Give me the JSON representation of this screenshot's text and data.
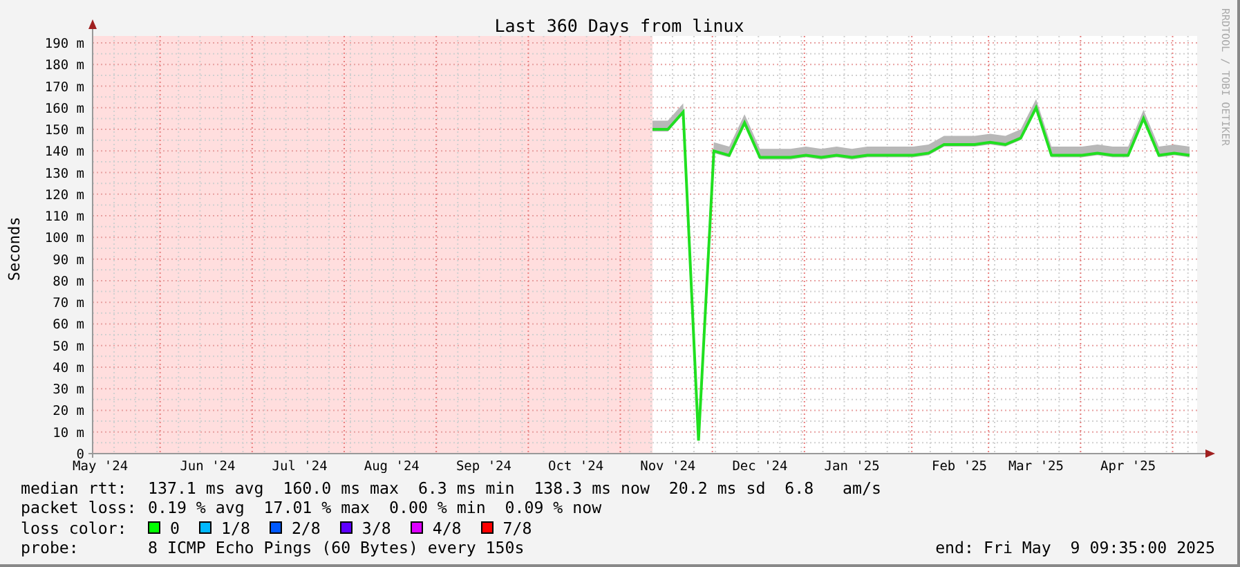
{
  "graph": {
    "credit": "RRDTOOL / TOBI OETIKER",
    "chart_data": {
      "type": "line",
      "title": "Last 360 Days from linux",
      "ylabel": "Seconds",
      "categories": [
        "May '24",
        null,
        null,
        null,
        null,
        null,
        null,
        "Jun '24",
        null,
        null,
        null,
        null,
        null,
        "Jul '24",
        null,
        null,
        null,
        null,
        null,
        "Aug '24",
        null,
        null,
        null,
        null,
        null,
        "Sep '24",
        null,
        null,
        null,
        null,
        null,
        "Oct '24",
        null,
        null,
        null,
        null,
        null,
        "Nov '24",
        null,
        null,
        null,
        null,
        null,
        "Dec '24",
        null,
        null,
        null,
        null,
        null,
        "Jan '25",
        null,
        null,
        null,
        null,
        null,
        null,
        "Feb '25",
        null,
        null,
        null,
        null,
        "Mar '25",
        null,
        null,
        null,
        null,
        null,
        "Apr '25",
        null,
        null,
        null,
        null
      ],
      "series": [
        {
          "name": "median rtt:",
          "color": "#20e020",
          "values": [
            null,
            null,
            null,
            null,
            null,
            null,
            null,
            null,
            null,
            null,
            null,
            null,
            null,
            null,
            null,
            null,
            null,
            null,
            null,
            null,
            null,
            null,
            null,
            null,
            null,
            null,
            null,
            null,
            null,
            null,
            null,
            null,
            null,
            null,
            null,
            null,
            150,
            150,
            158,
            6,
            140,
            138,
            153,
            137,
            137,
            137,
            138,
            137,
            138,
            137,
            138,
            138,
            138,
            138,
            139,
            143,
            143,
            143,
            144,
            143,
            146,
            160,
            138,
            138,
            138,
            139,
            138,
            138,
            155,
            138,
            139,
            138
          ]
        }
      ],
      "ylim": [
        0,
        190
      ],
      "grid": true,
      "yticks": [
        {
          "value": 0,
          "label": "0"
        },
        {
          "value": 10,
          "label": "10 m"
        },
        {
          "value": 20,
          "label": "20 m"
        },
        {
          "value": 30,
          "label": "30 m"
        },
        {
          "value": 40,
          "label": "40 m"
        },
        {
          "value": 50,
          "label": "50 m"
        },
        {
          "value": 60,
          "label": "60 m"
        },
        {
          "value": 70,
          "label": "70 m"
        },
        {
          "value": 80,
          "label": "80 m"
        },
        {
          "value": 90,
          "label": "90 m"
        },
        {
          "value": 100,
          "label": "100 m"
        },
        {
          "value": 110,
          "label": "110 m"
        },
        {
          "value": 120,
          "label": "120 m"
        },
        {
          "value": 130,
          "label": "130 m"
        },
        {
          "value": 140,
          "label": "140 m"
        },
        {
          "value": 150,
          "label": "150 m"
        },
        {
          "value": 160,
          "label": "160 m"
        },
        {
          "value": 170,
          "label": "170 m"
        },
        {
          "value": 180,
          "label": "180 m"
        },
        {
          "value": 190,
          "label": "190 m"
        }
      ]
    }
  },
  "legend": {
    "rows": [
      {
        "value": "137.1 ms avg  160.0 ms max  6.3 ms min  138.3 ms now  20.2 ms sd  6.8   am/s"
      },
      {
        "label": "packet loss:",
        "value": "0.19 % avg  17.01 % max  0.00 % min  0.09 % now"
      }
    ],
    "loss_colors": {
      "label": "loss color:",
      "items": [
        {
          "label": "0",
          "color": "#00ff00"
        },
        {
          "label": "1/8",
          "color": "#00b8ff"
        },
        {
          "label": "2/8",
          "color": "#0059ff"
        },
        {
          "label": "3/8",
          "color": "#5e00ff"
        },
        {
          "label": "4/8",
          "color": "#dd00ff"
        },
        {
          "label": "7/8",
          "color": "#ff0000"
        }
      ]
    },
    "probe": {
      "label": "probe:",
      "value": "8 ICMP Echo Pings (60 Bytes) every 150s"
    },
    "end": "end: Fri May  9 09:35:00 2025"
  }
}
